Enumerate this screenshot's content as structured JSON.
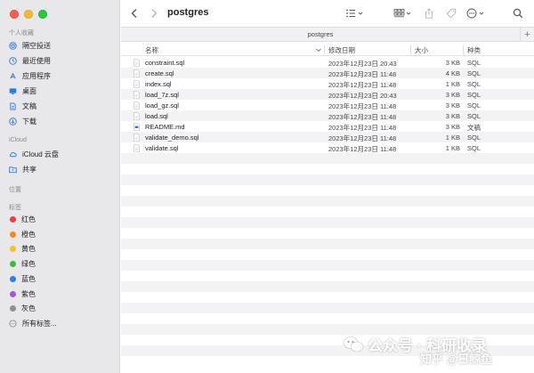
{
  "sidebar": {
    "favorites_title": "个人收藏",
    "favorites": [
      {
        "label": "隔空投送",
        "icon": "airdrop-icon"
      },
      {
        "label": "最近使用",
        "icon": "clock-icon"
      },
      {
        "label": "应用程序",
        "icon": "applications-icon"
      },
      {
        "label": "桌面",
        "icon": "desktop-icon"
      },
      {
        "label": "文稿",
        "icon": "document-icon"
      },
      {
        "label": "下载",
        "icon": "download-icon"
      }
    ],
    "icloud_title": "iCloud",
    "icloud": [
      {
        "label": "iCloud 云盘",
        "icon": "cloud-icon"
      },
      {
        "label": "共享",
        "icon": "shared-folder-icon"
      }
    ],
    "locations_title": "位置",
    "tags_title": "标签",
    "tags": [
      {
        "label": "红色",
        "color": "#f23b3b"
      },
      {
        "label": "橙色",
        "color": "#f7891b"
      },
      {
        "label": "黄色",
        "color": "#f6c21d"
      },
      {
        "label": "绿色",
        "color": "#3dbb3b"
      },
      {
        "label": "蓝色",
        "color": "#2b7cf5"
      },
      {
        "label": "紫色",
        "color": "#a457d8"
      },
      {
        "label": "灰色",
        "color": "#8e8e93"
      }
    ],
    "all_tags": "所有标签..."
  },
  "toolbar": {
    "title": "postgres"
  },
  "pathbar": {
    "label": "postgres"
  },
  "columns": {
    "name": "名称",
    "date": "修改日期",
    "size": "大小",
    "kind": "种类"
  },
  "files": [
    {
      "name": "constraint.sql",
      "date": "2023年12月23日 20:43",
      "size": "3 KB",
      "kind": "SQL",
      "icon": "sql-file-icon"
    },
    {
      "name": "create.sql",
      "date": "2023年12月23日 11:48",
      "size": "4 KB",
      "kind": "SQL",
      "icon": "sql-file-icon"
    },
    {
      "name": "index.sql",
      "date": "2023年12月23日 11:48",
      "size": "1 KB",
      "kind": "SQL",
      "icon": "sql-file-icon"
    },
    {
      "name": "load_7z.sql",
      "date": "2023年12月23日 20:43",
      "size": "3 KB",
      "kind": "SQL",
      "icon": "sql-file-icon"
    },
    {
      "name": "load_gz.sql",
      "date": "2023年12月23日 11:48",
      "size": "3 KB",
      "kind": "SQL",
      "icon": "sql-file-icon"
    },
    {
      "name": "load.sql",
      "date": "2023年12月23日 11:48",
      "size": "3 KB",
      "kind": "SQL",
      "icon": "sql-file-icon"
    },
    {
      "name": "README.md",
      "date": "2023年12月23日 11:48",
      "size": "3 KB",
      "kind": "文稿",
      "icon": "markdown-file-icon"
    },
    {
      "name": "validate_demo.sql",
      "date": "2023年12月23日 11:48",
      "size": "1 KB",
      "kind": "SQL",
      "icon": "sql-file-icon"
    },
    {
      "name": "validate.sql",
      "date": "2023年12月23日 11:48",
      "size": "1 KB",
      "kind": "SQL",
      "icon": "sql-file-icon"
    }
  ],
  "watermark": {
    "text": "公众号 · 科研收录",
    "text2": "知乎 @日鲸鱼"
  }
}
